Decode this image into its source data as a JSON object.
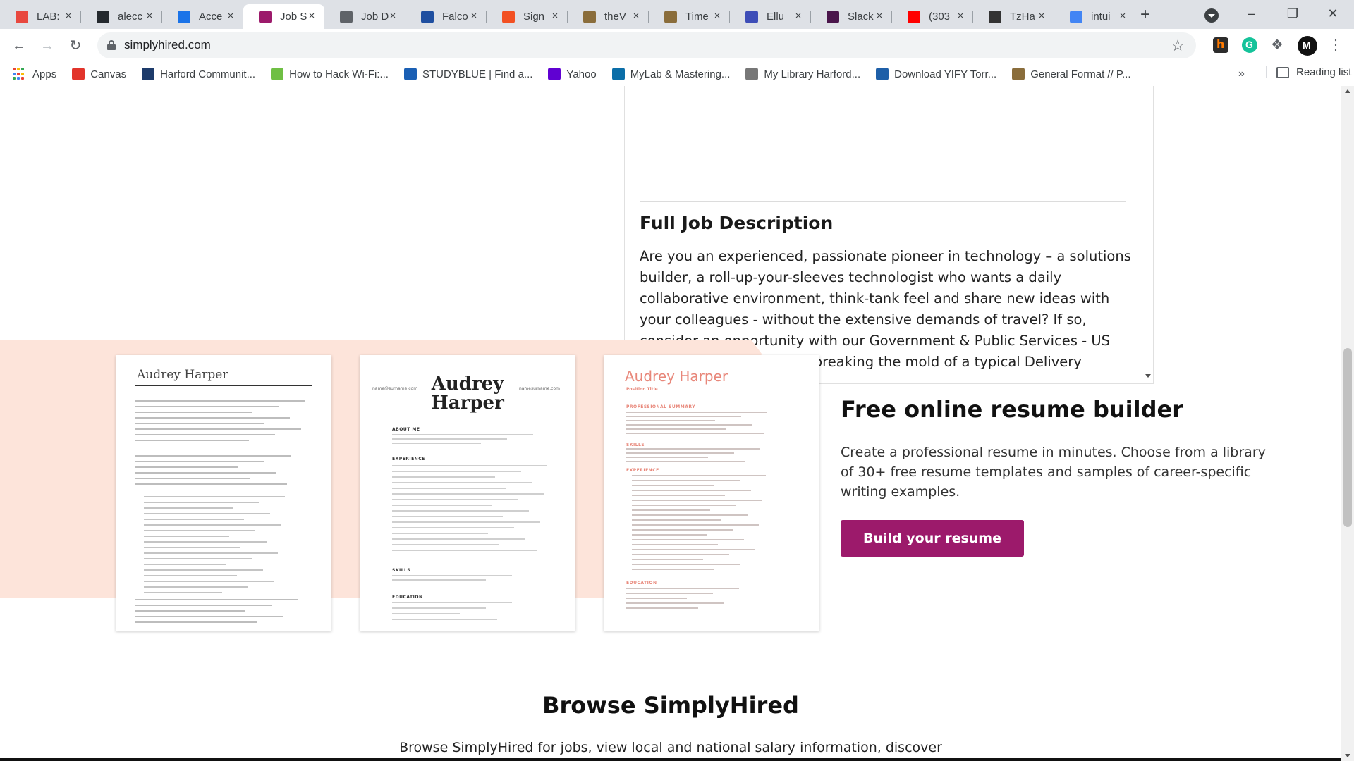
{
  "browser": {
    "tabs": [
      {
        "title": "LAB:",
        "color": "#e8483f"
      },
      {
        "title": "alecc",
        "color": "#24292e"
      },
      {
        "title": "Acce",
        "color": "#1a73e8"
      },
      {
        "title": "Job S",
        "color": "#9c1a6b",
        "active": true
      },
      {
        "title": "Job D",
        "color": "#5f6368"
      },
      {
        "title": "Falco",
        "color": "#1f4fa0"
      },
      {
        "title": "Sign",
        "color": "#f25022"
      },
      {
        "title": "theV",
        "color": "#8a6d3b"
      },
      {
        "title": "Time",
        "color": "#8a6d3b"
      },
      {
        "title": "Ellu",
        "color": "#3d4db7"
      },
      {
        "title": "Slack",
        "color": "#4a154b"
      },
      {
        "title": "(303",
        "color": "#ff0000"
      },
      {
        "title": "TzHa",
        "color": "#333333"
      },
      {
        "title": "intui",
        "color": "#4285f4"
      }
    ],
    "url": "simplyhired.com",
    "bookmarks": [
      {
        "label": "Apps"
      },
      {
        "label": "Canvas",
        "color": "#e2342b"
      },
      {
        "label": "Harford Communit...",
        "color": "#1d3b6b"
      },
      {
        "label": "How to Hack Wi-Fi:...",
        "color": "#6fbf44"
      },
      {
        "label": "STUDYBLUE | Find a...",
        "color": "#1a5fb4"
      },
      {
        "label": "Yahoo",
        "color": "#6001d2"
      },
      {
        "label": "MyLab & Mastering...",
        "color": "#0b6ea8"
      },
      {
        "label": "My Library Harford...",
        "color": "#777777"
      },
      {
        "label": "Download YIFY Torr...",
        "color": "#1e5fa8"
      },
      {
        "label": "General Format // P...",
        "color": "#8a6d3b"
      }
    ],
    "more_bookmarks": "»",
    "reading_list": "Reading list"
  },
  "job_description": {
    "heading": "Full Job Description",
    "text": "Are you an experienced, passionate pioneer in technology – a solutions builder, a roll-up-your-sleeves technologist who wants a daily collaborative environment, think-tank feel and share new ideas with your colleagues - without the extensive demands of travel? If so, consider an opportunity with our Government & Public Services - US Delivery Center – we are breaking the mold of a typical Delivery Center."
  },
  "resume_builder": {
    "title": "Free online resume builder",
    "text": "Create a professional resume in minutes. Choose from a library of 30+ free resume templates and samples of career-specific writing examples.",
    "button": "Build your resume",
    "samples": [
      {
        "first": "Audrey",
        "last": "Harper"
      },
      {
        "first": "Audrey",
        "last": "Harper",
        "email_left": "name@surname.com",
        "email_right": "namesurname.com",
        "sections": [
          "ABOUT ME",
          "EXPERIENCE",
          "SKILLS",
          "EDUCATION"
        ]
      },
      {
        "name": "Audrey Harper",
        "subtitle": "Position Title",
        "sections": [
          "PROFESSIONAL SUMMARY",
          "SKILLS",
          "EXPERIENCE",
          "EDUCATION"
        ]
      }
    ]
  },
  "browse": {
    "title": "Browse SimplyHired",
    "text": "Browse SimplyHired for jobs, view local and national salary information, discover"
  },
  "colors": {
    "brand": "#9c1a6b",
    "band": "#fde4da"
  }
}
